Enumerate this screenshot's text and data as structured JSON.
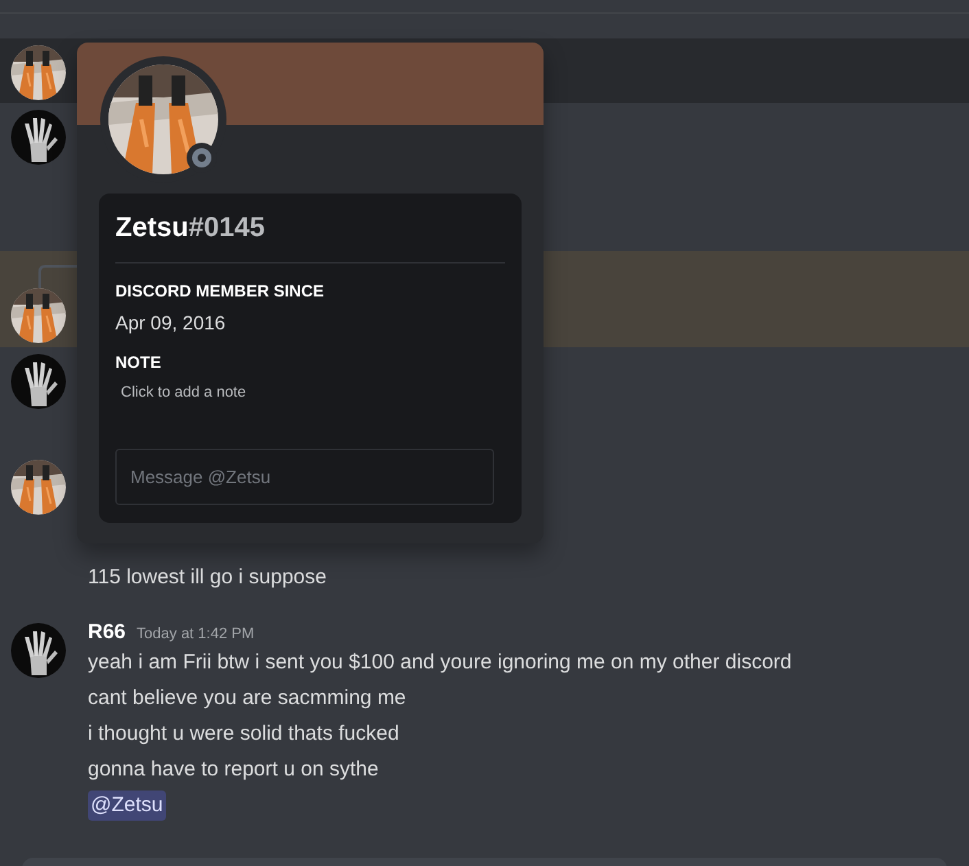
{
  "popout": {
    "username": "Zetsu",
    "discriminator": "#0145",
    "online": false,
    "avatar": {
      "color": "#d9782f"
    },
    "member_since": {
      "heading": "DISCORD MEMBER SINCE",
      "text": "Apr 09, 2016"
    },
    "note": {
      "heading": "NOTE",
      "placeholder": "Click to add a note"
    },
    "message_field": {
      "placeholder": "Message @Zetsu"
    }
  },
  "messages": [
    {
      "avatar": {
        "color": "#d9782f"
      },
      "hovered": true,
      "highlighted": false,
      "reply": false
    },
    {
      "avatar": {
        "color": "#0b0b0b"
      },
      "hovered": false,
      "highlighted": false,
      "reply": false
    },
    {
      "avatar": {
        "color": "#d9782f"
      },
      "hovered": false,
      "highlighted": true,
      "reply": true
    },
    {
      "avatar": {
        "color": "#0b0b0b"
      },
      "hovered": false,
      "highlighted": false,
      "reply": false
    },
    {
      "avatar": {
        "color": "#d9782f"
      },
      "hovered": false,
      "highlighted": false,
      "reply": false,
      "lines": [
        {
          "text": "115 lowest ill go i suppose"
        }
      ]
    },
    {
      "avatar": {
        "color": "#0b0b0b"
      },
      "hovered": false,
      "highlighted": false,
      "reply": false,
      "author": "R66",
      "timestamp": "Today at 1:42 PM",
      "lines": [
        {
          "text": "yeah i am Frii btw i sent you $100 and youre ignoring me on my other discord"
        },
        {
          "text": "cant believe you are sacmming me"
        },
        {
          "text": "i thought u were solid thats fucked"
        },
        {
          "text": "gonna have to report u on sythe"
        },
        {
          "kind": "mention",
          "text": "@Zetsu"
        }
      ]
    }
  ]
}
